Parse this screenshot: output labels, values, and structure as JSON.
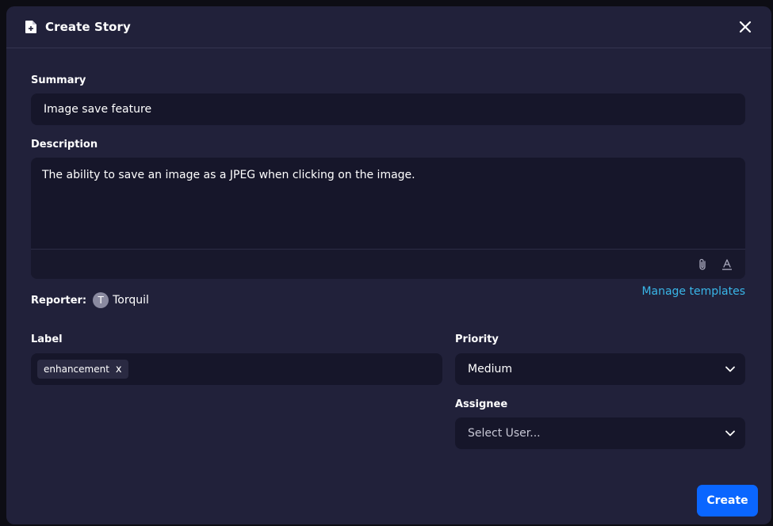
{
  "dialog": {
    "title": "Create Story",
    "icons": {
      "title": "file-plus-icon",
      "close": "close-icon"
    }
  },
  "summary": {
    "label": "Summary",
    "value": "Image save feature"
  },
  "description": {
    "label": "Description",
    "value": "The ability to save an image as a JPEG when clicking on the image.",
    "toolbar_icons": [
      "paperclip-icon",
      "text-format-icon"
    ]
  },
  "reporter": {
    "label": "Reporter:",
    "avatar_initial": "T",
    "name": "Torquil"
  },
  "manage_templates": "Manage templates",
  "label_field": {
    "label": "Label",
    "chips": [
      {
        "text": "enhancement",
        "remove": "x"
      }
    ]
  },
  "priority": {
    "label": "Priority",
    "value": "Medium"
  },
  "assignee": {
    "label": "Assignee",
    "placeholder": "Select User..."
  },
  "create_button": "Create",
  "colors": {
    "modal_bg": "#21213a",
    "input_bg": "#16162a",
    "accent": "#0a66ff",
    "link": "#39b6e8"
  }
}
